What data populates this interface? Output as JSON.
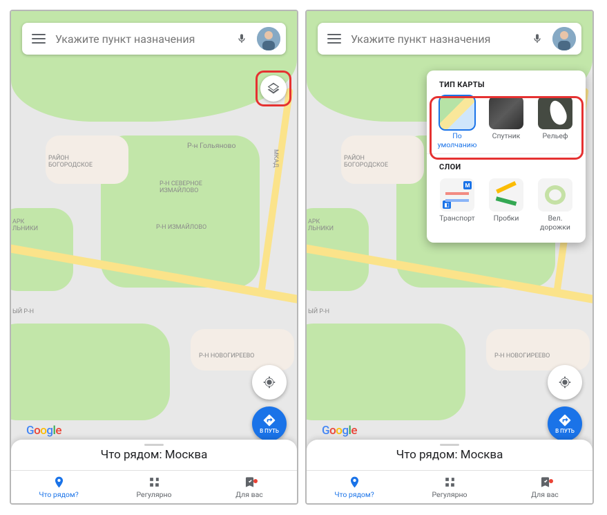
{
  "search": {
    "placeholder": "Укажите пункт назначения"
  },
  "sheet": {
    "title": "Что рядом: Москва"
  },
  "bottom_nav": {
    "items": [
      {
        "label": "Что рядом?"
      },
      {
        "label": "Регулярно"
      },
      {
        "label": "Для вас"
      }
    ]
  },
  "fab_navigate": {
    "label": "В ПУТЬ"
  },
  "map_labels": {
    "bogorodskoe": "РАЙОН\nБОГОРОДСКОЕ",
    "golyanovo": "Р-н Гольяново",
    "sev_izmailovo": "Р-Н СЕВЕРНОЕ\nИЗМАЙЛОВО",
    "izmailovo": "Р-Н ИЗМАЙЛОВО",
    "park_sokolniki": "АРК\nЛЬНИКИ",
    "novogireevo": "Р-Н НОВОГИРЕЕВО",
    "mkad": "МКАД",
    "ryn_left": "ЫЙ Р-Н"
  },
  "layers_panel": {
    "section_map_type": "ТИП КАРТЫ",
    "section_layers": "СЛОИ",
    "map_types": [
      {
        "key": "default",
        "label": "По\nумолчанию",
        "active": true
      },
      {
        "key": "satellite",
        "label": "Спутник"
      },
      {
        "key": "terrain",
        "label": "Рельеф"
      }
    ],
    "layers": [
      {
        "key": "transit",
        "label": "Транспорт"
      },
      {
        "key": "traffic",
        "label": "Пробки"
      },
      {
        "key": "bike",
        "label": "Вел.\nдорожки"
      }
    ]
  },
  "google": "Google"
}
